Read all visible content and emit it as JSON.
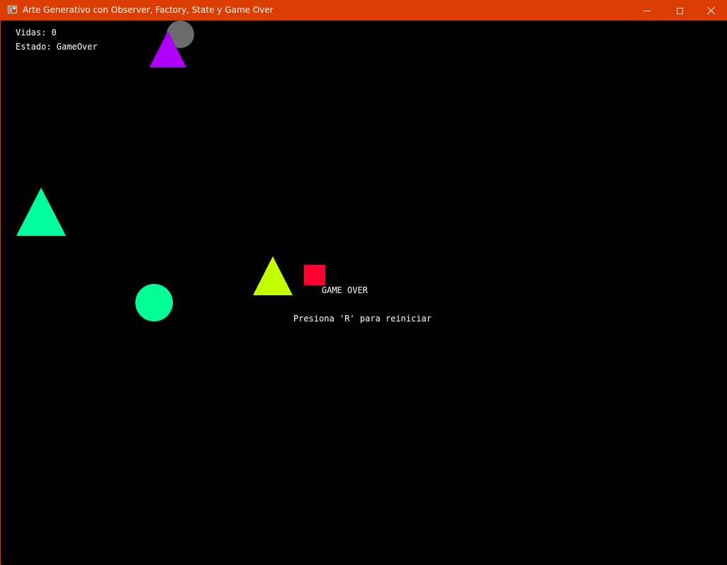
{
  "window": {
    "title": "Arte Generativo con Observer, Factory, State y Game Over",
    "accent_color": "#dc3d00",
    "controls": [
      "minimize",
      "maximize",
      "close"
    ]
  },
  "hud": {
    "lives": "Vidas: 0",
    "state": "Estado: GameOver"
  },
  "game_over": {
    "title": "GAME OVER",
    "restart_prompt": "Presiona 'R' para reiniciar"
  },
  "shapes": [
    {
      "name": "gray-circle",
      "type": "circle",
      "color": "#6b6b6b"
    },
    {
      "name": "purple-triangle",
      "type": "triangle",
      "color": "#ad00ff"
    },
    {
      "name": "teal-triangle",
      "type": "triangle",
      "color": "#00ff9c"
    },
    {
      "name": "lime-triangle",
      "type": "triangle",
      "color": "#c2ff00"
    },
    {
      "name": "red-square",
      "type": "square",
      "color": "#ff0033"
    },
    {
      "name": "teal-circle",
      "type": "circle",
      "color": "#00ff94"
    }
  ]
}
